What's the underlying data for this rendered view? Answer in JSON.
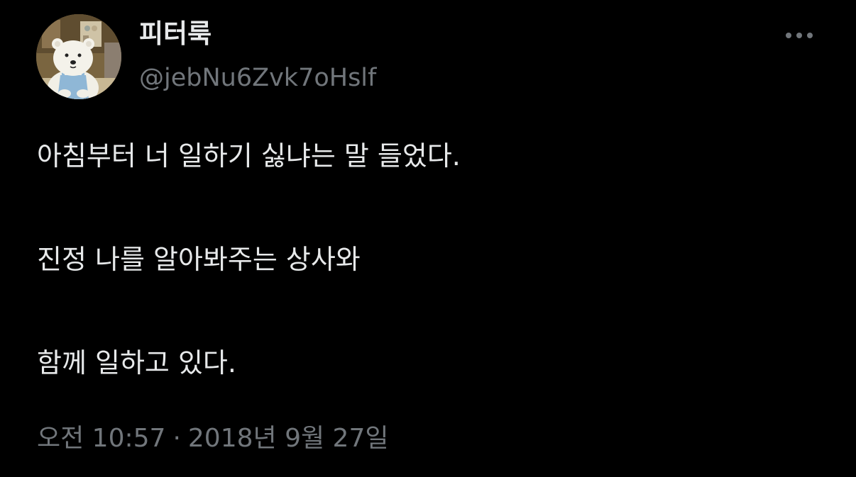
{
  "author": {
    "display_name": "피터룩",
    "handle": "@jebNu6Zvk7oHslf",
    "avatar_icon": "polar-bear-avatar-icon"
  },
  "more_icon": "more-horizontal-icon",
  "tweet": {
    "lines": [
      "아침부터 너 일하기 싫냐는 말 들었다.",
      "진정 나를 알아봐주는 상사와",
      "함께 일하고 있다."
    ]
  },
  "meta": {
    "time": "오전 10:57",
    "separator": "·",
    "date": "2018년 9월 27일"
  },
  "colors": {
    "background": "#000000",
    "primary_text": "#e7e9ea",
    "secondary_text": "#71767b"
  }
}
